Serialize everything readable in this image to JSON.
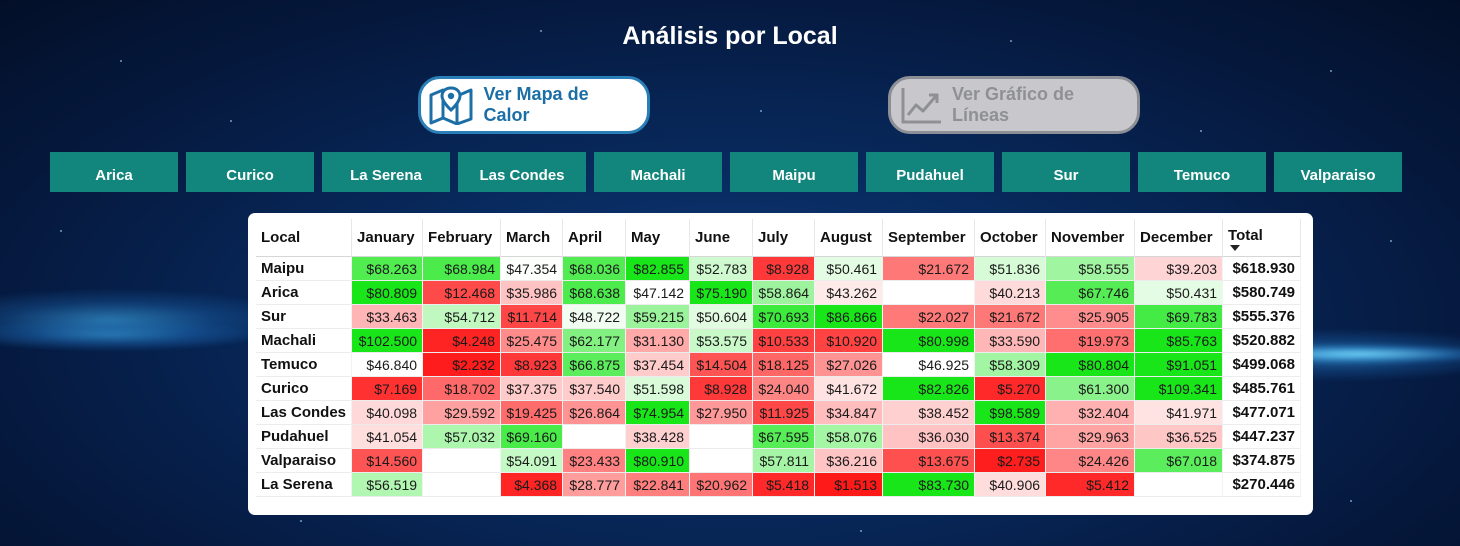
{
  "header": {
    "title": "Análisis por Local"
  },
  "buttons": {
    "heatmap_label": "Ver Mapa de Calor",
    "heatmap_icon": "map-pin-icon",
    "lines_label": "Ver Gráfico de Líneas",
    "lines_icon": "line-chart-icon"
  },
  "locals": [
    "Arica",
    "Curico",
    "La Serena",
    "Las Condes",
    "Machali",
    "Maipu",
    "Pudahuel",
    "Sur",
    "Temuco",
    "Valparaiso"
  ],
  "table": {
    "columns": [
      "Local",
      "January",
      "February",
      "March",
      "April",
      "May",
      "June",
      "July",
      "August",
      "September",
      "October",
      "November",
      "December",
      "Total"
    ],
    "sorted_column": "Total",
    "colors": {
      "strong_red": "#ff1a1a",
      "light_red": "#ffd6d6",
      "neutral": "#ffffff",
      "light_green": "#d9ffd9",
      "strong_green": "#19e619"
    },
    "rows": [
      {
        "local": "Maipu",
        "values": [
          "$68.263",
          "$68.984",
          "$47.354",
          "$68.036",
          "$82.855",
          "$52.783",
          "$8.928",
          "$50.461",
          "$21.672",
          "$51.836",
          "$58.555",
          "$39.203"
        ],
        "total": "$618.930"
      },
      {
        "local": "Arica",
        "values": [
          "$80.809",
          "$12.468",
          "$35.986",
          "$68.638",
          "$47.142",
          "$75.190",
          "$58.864",
          "$43.262",
          "",
          "$40.213",
          "$67.746",
          "$50.431"
        ],
        "total": "$580.749"
      },
      {
        "local": "Sur",
        "values": [
          "$33.463",
          "$54.712",
          "$11.714",
          "$48.722",
          "$59.215",
          "$50.604",
          "$70.693",
          "$86.866",
          "$22.027",
          "$21.672",
          "$25.905",
          "$69.783"
        ],
        "total": "$555.376"
      },
      {
        "local": "Machali",
        "values": [
          "$102.500",
          "$4.248",
          "$25.475",
          "$62.177",
          "$31.130",
          "$53.575",
          "$10.533",
          "$10.920",
          "$80.998",
          "$33.590",
          "$19.973",
          "$85.763"
        ],
        "total": "$520.882"
      },
      {
        "local": "Temuco",
        "values": [
          "$46.840",
          "$2.232",
          "$8.923",
          "$66.875",
          "$37.454",
          "$14.504",
          "$18.125",
          "$27.026",
          "$46.925",
          "$58.309",
          "$80.804",
          "$91.051"
        ],
        "total": "$499.068"
      },
      {
        "local": "Curico",
        "values": [
          "$7.169",
          "$18.702",
          "$37.375",
          "$37.540",
          "$51.598",
          "$8.928",
          "$24.040",
          "$41.672",
          "$82.826",
          "$5.270",
          "$61.300",
          "$109.341"
        ],
        "total": "$485.761"
      },
      {
        "local": "Las Condes",
        "values": [
          "$40.098",
          "$29.592",
          "$19.425",
          "$26.864",
          "$74.954",
          "$27.950",
          "$11.925",
          "$34.847",
          "$38.452",
          "$98.589",
          "$32.404",
          "$41.971"
        ],
        "total": "$477.071"
      },
      {
        "local": "Pudahuel",
        "values": [
          "$41.054",
          "$57.032",
          "$69.160",
          "",
          "$38.428",
          "",
          "$67.595",
          "$58.076",
          "$36.030",
          "$13.374",
          "$29.963",
          "$36.525"
        ],
        "total": "$447.237"
      },
      {
        "local": "Valparaiso",
        "values": [
          "$14.560",
          "",
          "$54.091",
          "$23.433",
          "$80.910",
          "",
          "$57.811",
          "$36.216",
          "$13.675",
          "$2.735",
          "$24.426",
          "$67.018"
        ],
        "total": "$374.875"
      },
      {
        "local": "La Serena",
        "values": [
          "$56.519",
          "",
          "$4.368",
          "$28.777",
          "$22.841",
          "$20.962",
          "$5.418",
          "$1.513",
          "$83.730",
          "$40.906",
          "$5.412",
          ""
        ],
        "total": "$270.446"
      }
    ]
  }
}
